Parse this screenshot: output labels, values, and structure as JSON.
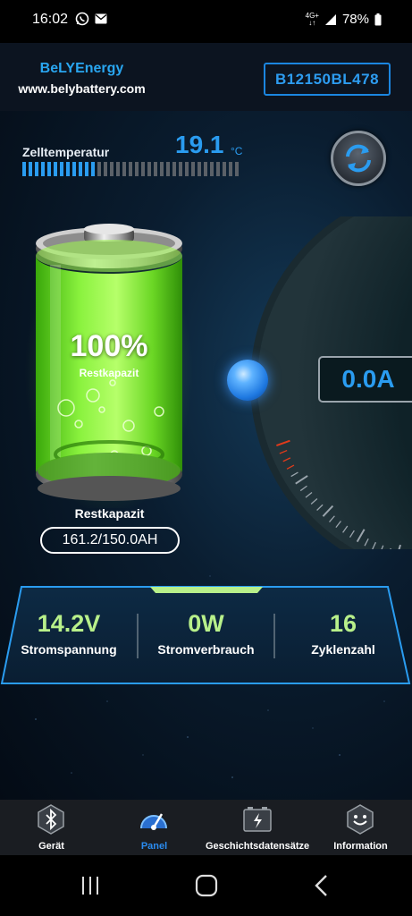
{
  "status_bar": {
    "time": "16:02",
    "network": "4G+",
    "battery": "78%"
  },
  "header": {
    "brand_name": "BeLYEnergy",
    "brand_url": "www.belybattery.com",
    "device_id": "B12150BL478"
  },
  "temperature": {
    "label": "Zelltemperatur",
    "value": "19.1",
    "unit": "°C",
    "level_fraction": 0.33
  },
  "battery": {
    "percent": "100%",
    "inner_label": "Restkapazit",
    "capacity_title": "Restkapazit",
    "capacity_value": "161.2/150.0AH",
    "level_fraction": 1.0
  },
  "gauge": {
    "current": "0.0A"
  },
  "stats": [
    {
      "value": "14.2V",
      "label": "Stromspannung"
    },
    {
      "value": "0W",
      "label": "Stromverbrauch"
    },
    {
      "value": "16",
      "label": "Zyklenzahl"
    }
  ],
  "tabs": [
    {
      "label": "Gerät",
      "icon": "bluetooth-icon",
      "active": false
    },
    {
      "label": "Panel",
      "icon": "speedometer-icon",
      "active": true
    },
    {
      "label": "Geschichtsdatensätze",
      "icon": "history-battery-icon",
      "active": false
    },
    {
      "label": "Information",
      "icon": "smiley-icon",
      "active": false
    }
  ],
  "colors": {
    "accent_blue": "#2a9cf0",
    "stat_green": "#b8f08a",
    "battery_green": "#5fe01e"
  }
}
